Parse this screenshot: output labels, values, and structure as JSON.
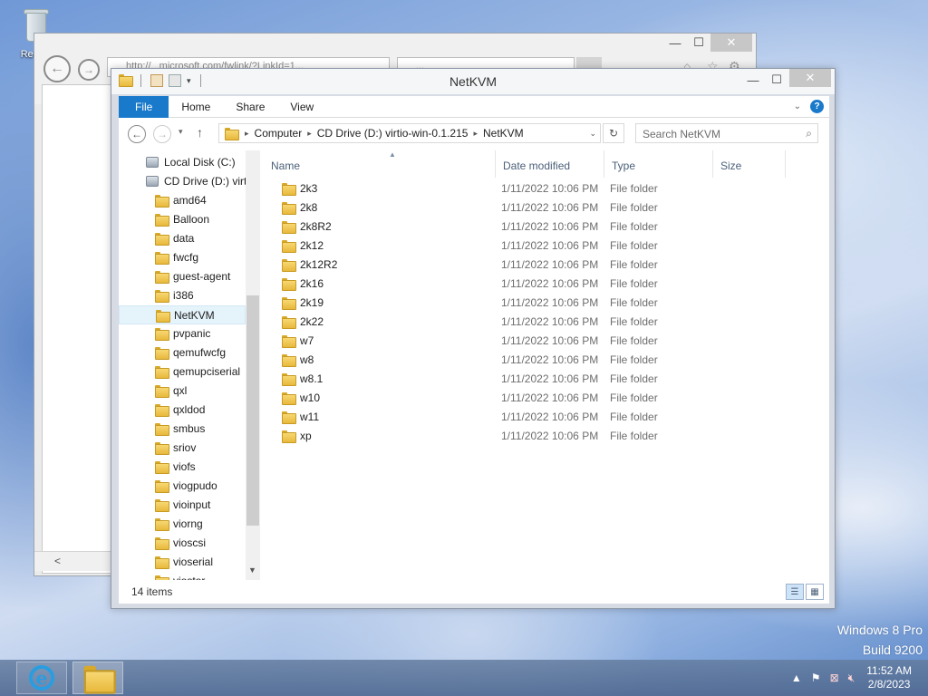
{
  "desktop": {
    "recycle_bin_label": "Recyc",
    "watermark_line1": "Windows 8 Pro",
    "watermark_line2": "Build 9200"
  },
  "ie_window": {
    "address_text": "http://...microsoft.com/fwlink/?LinkId=1...",
    "tab_text": "...",
    "minimize_glyph": "—",
    "maximize_glyph": "☐",
    "close_glyph": "✕"
  },
  "explorer": {
    "title": "NetKVM",
    "ribbon_tabs": [
      "File",
      "Home",
      "Share",
      "View"
    ],
    "breadcrumb": [
      "Computer",
      "CD Drive (D:) virtio-win-0.1.215",
      "NetKVM"
    ],
    "search_placeholder": "Search NetKVM",
    "columns": {
      "name": "Name",
      "date_modified": "Date modified",
      "type": "Type",
      "size": "Size"
    },
    "tree": [
      {
        "label": "Local Disk (C:)",
        "icon": "drive-icon",
        "level": 1
      },
      {
        "label": "CD Drive (D:) virt",
        "icon": "cd-drive-icon",
        "level": 1
      },
      {
        "label": "amd64",
        "icon": "folder-icon",
        "level": 2
      },
      {
        "label": "Balloon",
        "icon": "folder-icon",
        "level": 2
      },
      {
        "label": "data",
        "icon": "folder-icon",
        "level": 2
      },
      {
        "label": "fwcfg",
        "icon": "folder-icon",
        "level": 2
      },
      {
        "label": "guest-agent",
        "icon": "folder-icon",
        "level": 2
      },
      {
        "label": "i386",
        "icon": "folder-icon",
        "level": 2
      },
      {
        "label": "NetKVM",
        "icon": "folder-icon",
        "level": 2,
        "selected": true
      },
      {
        "label": "pvpanic",
        "icon": "folder-icon",
        "level": 2
      },
      {
        "label": "qemufwcfg",
        "icon": "folder-icon",
        "level": 2
      },
      {
        "label": "qemupciserial",
        "icon": "folder-icon",
        "level": 2
      },
      {
        "label": "qxl",
        "icon": "folder-icon",
        "level": 2
      },
      {
        "label": "qxldod",
        "icon": "folder-icon",
        "level": 2
      },
      {
        "label": "smbus",
        "icon": "folder-icon",
        "level": 2
      },
      {
        "label": "sriov",
        "icon": "folder-icon",
        "level": 2
      },
      {
        "label": "viofs",
        "icon": "folder-icon",
        "level": 2
      },
      {
        "label": "viogpudo",
        "icon": "folder-icon",
        "level": 2
      },
      {
        "label": "vioinput",
        "icon": "folder-icon",
        "level": 2
      },
      {
        "label": "viorng",
        "icon": "folder-icon",
        "level": 2
      },
      {
        "label": "vioscsi",
        "icon": "folder-icon",
        "level": 2
      },
      {
        "label": "vioserial",
        "icon": "folder-icon",
        "level": 2
      },
      {
        "label": "viostor",
        "icon": "folder-icon",
        "level": 2
      }
    ],
    "files": [
      {
        "name": "2k3",
        "date": "1/11/2022 10:06 PM",
        "type": "File folder"
      },
      {
        "name": "2k8",
        "date": "1/11/2022 10:06 PM",
        "type": "File folder"
      },
      {
        "name": "2k8R2",
        "date": "1/11/2022 10:06 PM",
        "type": "File folder"
      },
      {
        "name": "2k12",
        "date": "1/11/2022 10:06 PM",
        "type": "File folder"
      },
      {
        "name": "2k12R2",
        "date": "1/11/2022 10:06 PM",
        "type": "File folder"
      },
      {
        "name": "2k16",
        "date": "1/11/2022 10:06 PM",
        "type": "File folder"
      },
      {
        "name": "2k19",
        "date": "1/11/2022 10:06 PM",
        "type": "File folder"
      },
      {
        "name": "2k22",
        "date": "1/11/2022 10:06 PM",
        "type": "File folder"
      },
      {
        "name": "w7",
        "date": "1/11/2022 10:06 PM",
        "type": "File folder"
      },
      {
        "name": "w8",
        "date": "1/11/2022 10:06 PM",
        "type": "File folder"
      },
      {
        "name": "w8.1",
        "date": "1/11/2022 10:06 PM",
        "type": "File folder"
      },
      {
        "name": "w10",
        "date": "1/11/2022 10:06 PM",
        "type": "File folder"
      },
      {
        "name": "w11",
        "date": "1/11/2022 10:06 PM",
        "type": "File folder"
      },
      {
        "name": "xp",
        "date": "1/11/2022 10:06 PM",
        "type": "File folder"
      }
    ],
    "status_count": "14 items"
  },
  "taskbar": {
    "time": "11:52 AM",
    "date": "2/8/2023"
  },
  "colors": {
    "ribbon_file_tab": "#1979ca",
    "selection": "#e5f3fb",
    "folder": "#e8b83c"
  }
}
